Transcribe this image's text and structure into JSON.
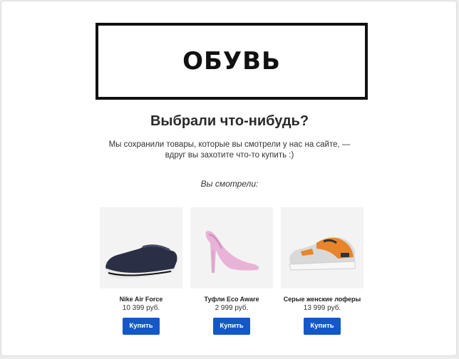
{
  "brand": {
    "logo_text": "ОБУВЬ"
  },
  "headline": "Выбрали что-нибудь?",
  "subtext": "Мы сохранили товары, которые вы смотрели у нас на сайте, — вдруг вы захотите что-то купить :)",
  "viewed_label": "Вы смотрели:",
  "products": [
    {
      "name": "Nike Air Force",
      "price": "10 399 руб.",
      "buy_label": "Купить",
      "image": "loafer-shoe-image"
    },
    {
      "name": "Туфли Eco Aware",
      "price": "2 999 руб.",
      "buy_label": "Купить",
      "image": "pink-pump-shoe-image"
    },
    {
      "name": "Серые женские лоферы",
      "price": "13 999 руб.",
      "buy_label": "Купить",
      "image": "sneaker-shoe-image"
    }
  ],
  "colors": {
    "button": "#1458c8",
    "image_bg": "#f3f3f3"
  }
}
